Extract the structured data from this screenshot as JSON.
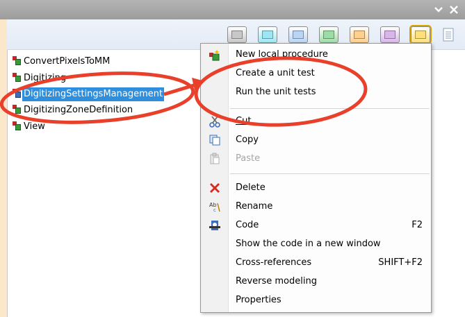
{
  "titlebar": {
    "buttons": [
      {
        "icon": "chevron-down-icon",
        "glyph": "⌄"
      },
      {
        "icon": "close-icon",
        "glyph": "✕"
      }
    ]
  },
  "toolbar": {
    "swatches": [
      {
        "name": "gray",
        "color": "#c8c8c8"
      },
      {
        "name": "cyan",
        "color": "#9ee6f2"
      },
      {
        "name": "light-blue",
        "color": "#b9d4f4"
      },
      {
        "name": "green",
        "color": "#9edca5"
      },
      {
        "name": "orange",
        "color": "#ffcf8c"
      },
      {
        "name": "purple",
        "color": "#d9b6ea"
      },
      {
        "name": "yellow",
        "color": "#ffe07a",
        "selected": true
      }
    ],
    "page_icon": "document-icon"
  },
  "tree": {
    "items": [
      {
        "label": "ConvertPixelsToMM"
      },
      {
        "label": "Digitizing"
      },
      {
        "label": "DigitizingSettingsManagement",
        "selected": true
      },
      {
        "label": "DigitizingZoneDefinition"
      },
      {
        "label": "View"
      }
    ]
  },
  "context_menu": {
    "items": [
      {
        "label": "New local procedure",
        "icon": "new-procedure-icon"
      },
      {
        "label": "Create a unit test"
      },
      {
        "label": "Run the unit tests"
      },
      {
        "label": "Cut",
        "icon": "scissors-icon",
        "underline": "C"
      },
      {
        "label": "Copy",
        "icon": "copy-icon"
      },
      {
        "label": "Paste",
        "icon": "paste-icon",
        "disabled": true
      },
      {
        "label": "Delete",
        "icon": "delete-icon"
      },
      {
        "label": "Rename",
        "icon": "rename-icon"
      },
      {
        "label": "Code",
        "icon": "code-icon",
        "shortcut": "F2"
      },
      {
        "label": "Show the code in a new window"
      },
      {
        "label": "Cross-references",
        "shortcut": "SHIFT+F2"
      },
      {
        "label": "Reverse modeling"
      },
      {
        "label": "Properties"
      }
    ]
  },
  "colors": {
    "highlight": "#2f8fdc",
    "annotation": "#e8402a",
    "background": "#fbe7c9"
  }
}
